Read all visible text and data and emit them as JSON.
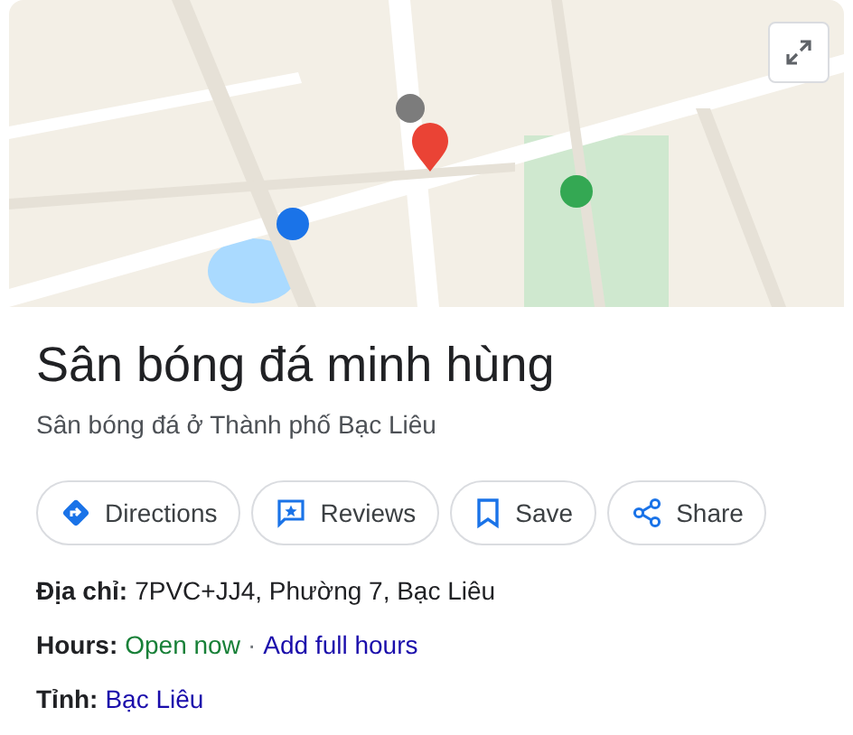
{
  "place": {
    "name": "Sân bóng đá minh hùng",
    "category": "Sân bóng đá ở Thành phố Bạc Liêu"
  },
  "actions": [
    {
      "label": "Directions",
      "kind": "directions"
    },
    {
      "label": "Reviews",
      "kind": "reviews"
    },
    {
      "label": "Save",
      "kind": "save"
    },
    {
      "label": "Share",
      "kind": "share"
    }
  ],
  "details": [
    {
      "kind": "plain",
      "label": "Địa chỉ:",
      "value": "7PVC+JJ4, Phường 7, Bạc Liêu"
    },
    {
      "kind": "hours",
      "label": "Hours:",
      "status": "Open now",
      "separator": "·",
      "link": "Add full hours"
    },
    {
      "kind": "link",
      "label": "Tỉnh:",
      "link": "Bạc Liêu"
    }
  ]
}
